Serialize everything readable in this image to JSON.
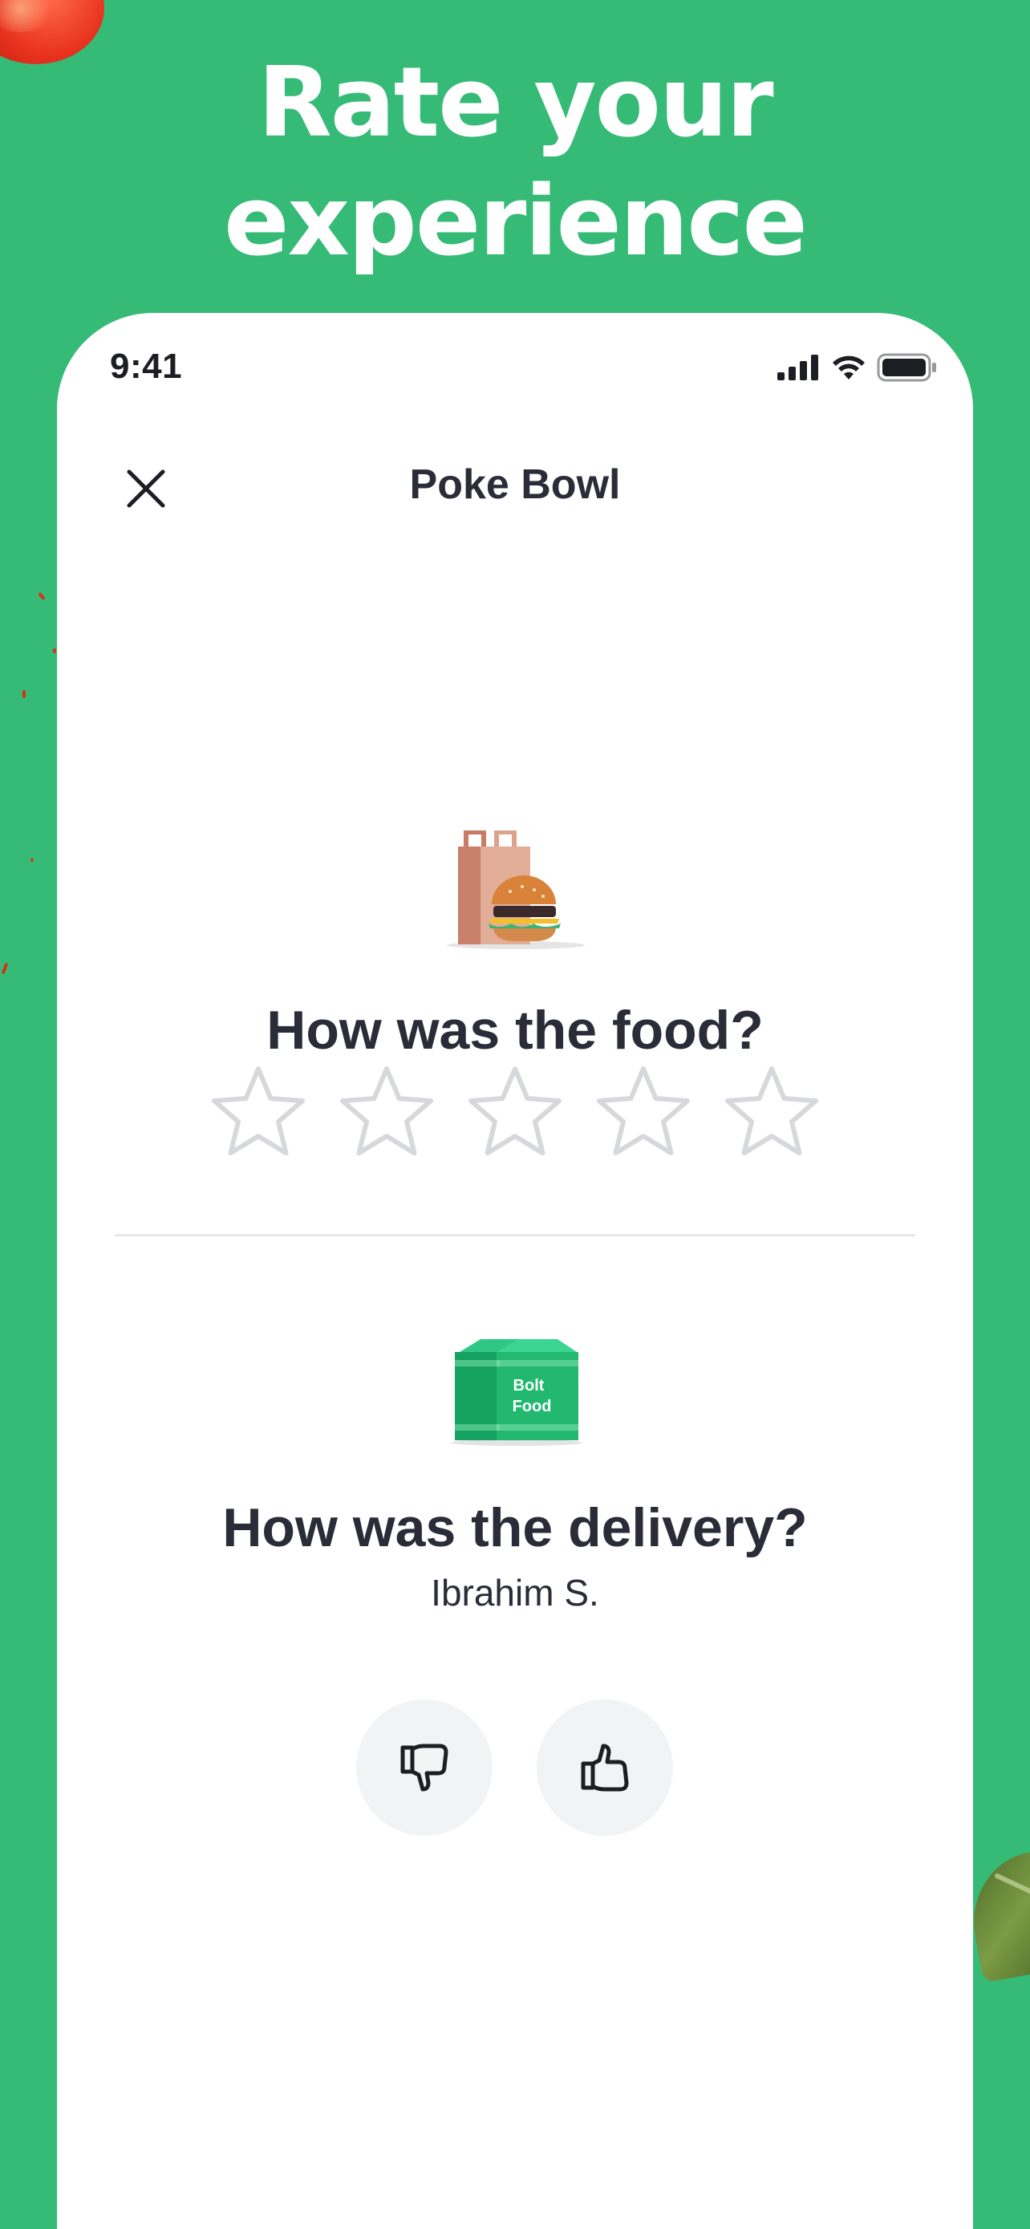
{
  "headline": {
    "line1": "Rate your",
    "line2": "experience"
  },
  "status_bar": {
    "time": "9:41"
  },
  "nav": {
    "title": "Poke Bowl",
    "close_icon": "close-icon"
  },
  "food_section": {
    "question": "How was the food?",
    "rating_max": 5,
    "rating_value": 0,
    "illustration": "food-bag-burger-illustration"
  },
  "delivery_section": {
    "question": "How was the delivery?",
    "courier_name": "Ibrahim S.",
    "bag_label_line1": "Bolt",
    "bag_label_line2": "Food",
    "thumbs_down_icon": "thumbs-down-icon",
    "thumbs_up_icon": "thumbs-up-icon"
  },
  "colors": {
    "background": "#36bb77",
    "text_dark": "#2a2d37",
    "star_outline": "#d7d8dc",
    "button_bg": "#f2f3f5",
    "bag_green": "#1fb36c"
  }
}
